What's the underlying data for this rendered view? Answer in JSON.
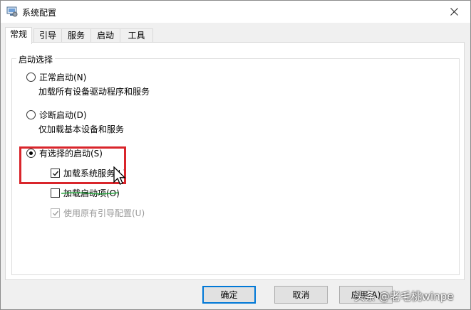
{
  "window": {
    "title": "系统配置"
  },
  "tabs": [
    {
      "label": "常规"
    },
    {
      "label": "引导"
    },
    {
      "label": "服务"
    },
    {
      "label": "启动"
    },
    {
      "label": "工具"
    }
  ],
  "startup_group": {
    "label": "启动选择",
    "normal": {
      "label": "正常启动(N)",
      "desc": "加载所有设备驱动程序和服务",
      "checked": false
    },
    "diagnostic": {
      "label": "诊断启动(D)",
      "desc": "仅加载基本设备和服务",
      "checked": false
    },
    "selective": {
      "label": "有选择的启动(S)",
      "checked": true,
      "options": [
        {
          "label": "加载系统服务(L)",
          "checked": true,
          "enabled": true
        },
        {
          "label": "加载启动项(O)",
          "checked": false,
          "enabled": true
        },
        {
          "label": "使用原有引导配置(U)",
          "checked": true,
          "enabled": false
        }
      ]
    }
  },
  "buttons": {
    "ok": "确定",
    "cancel": "取消",
    "apply": "应用(A)"
  },
  "watermark": "头条 @老毛桃winpe",
  "colors": {
    "highlight": "#d9252b",
    "accent": "#0078d7",
    "strike": "#22a33a"
  }
}
